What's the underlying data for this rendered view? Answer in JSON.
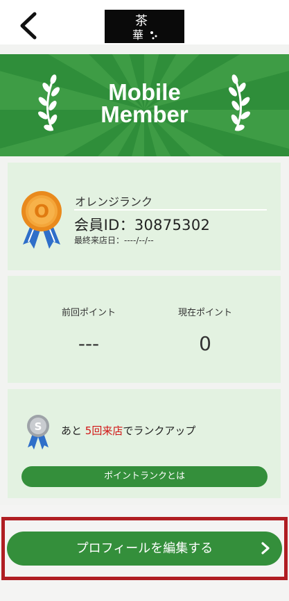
{
  "header": {
    "back_icon": "chevron-left-icon",
    "logo_icon": "brand-logo-icon",
    "logo_chars": [
      "茶",
      "華"
    ]
  },
  "hero": {
    "title_line1": "Mobile",
    "title_line2": "Member",
    "background_color": "#2f8e3a",
    "ray_color": "#4aa74f",
    "laurel_icon": "laurel-icon"
  },
  "rank_card": {
    "medal_icon": "orange-medal-icon",
    "medal_letter": "O",
    "rank_name": "オレンジランク",
    "member_id": "会員ID：30875302",
    "last_visit": "最終来店日：----/--/--"
  },
  "points_card": {
    "previous_label": "前回ポイント",
    "previous_value": "---",
    "current_label": "現在ポイント",
    "current_value": "0"
  },
  "rankup_card": {
    "medal_icon": "silver-medal-icon",
    "medal_letter": "S",
    "text_before": "あと ",
    "text_highlight": "5回来店",
    "text_after": "でランクアップ",
    "about_button": "ポイントランクとは"
  },
  "profile": {
    "edit_button": "プロフィールを編集する",
    "chevron_icon": "chevron-right-icon"
  },
  "colors": {
    "accent_green": "#348f3b",
    "card_bg": "#e3f2e1",
    "highlight_red": "#d11414",
    "focus_border": "#b01e23"
  }
}
